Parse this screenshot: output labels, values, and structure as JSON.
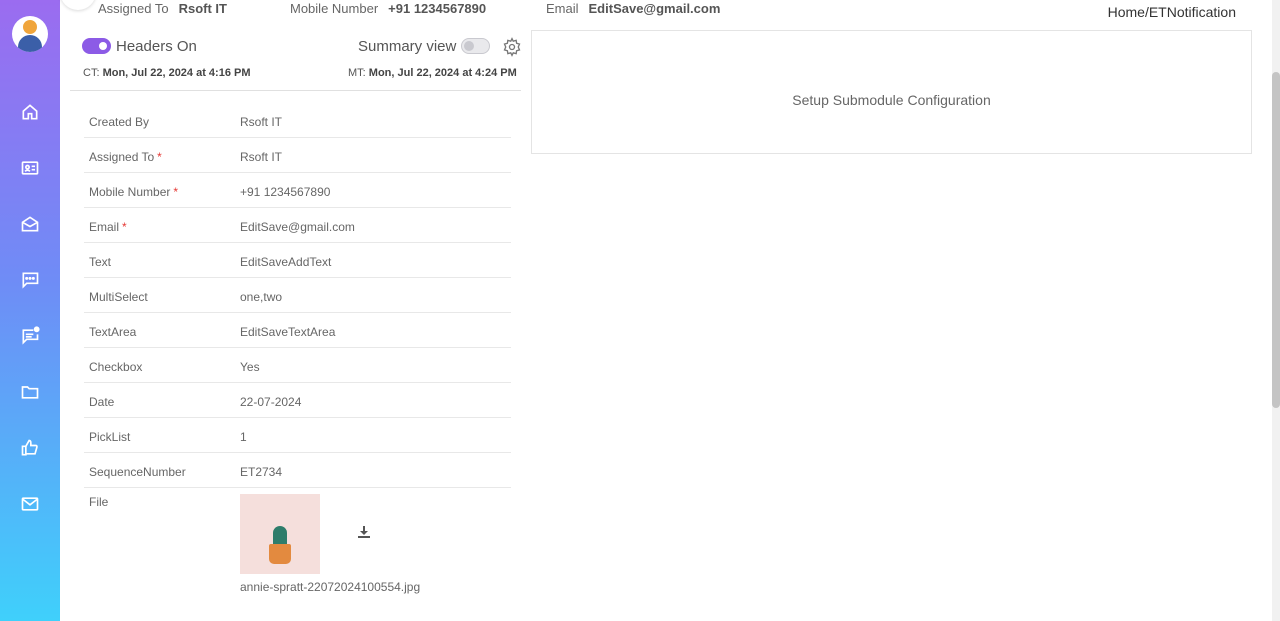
{
  "topbar": {
    "assigned_to_label": "Assigned To",
    "assigned_to_value": "Rsoft  IT",
    "mobile_label": "Mobile Number",
    "mobile_value": "+91 1234567890",
    "email_label": "Email",
    "email_value": "EditSave@gmail.com",
    "breadcrumb": "Home/ETNotification"
  },
  "header_panel": {
    "headers_toggle_label": "Headers On",
    "summary_view_label": "Summary view",
    "ct_label": "CT:",
    "ct_value": "Mon, Jul 22, 2024 at 4:16 PM",
    "mt_label": "MT:",
    "mt_value": "Mon, Jul 22, 2024 at 4:24 PM"
  },
  "fields": [
    {
      "label": "Created By",
      "value": "Rsoft IT",
      "required": ""
    },
    {
      "label": "Assigned To",
      "value": "Rsoft IT",
      "required": "*"
    },
    {
      "label": "Mobile Number",
      "value": "+91   1234567890",
      "required": "*"
    },
    {
      "label": "Email",
      "value": "EditSave@gmail.com",
      "required": "*"
    },
    {
      "label": "Text",
      "value": "EditSaveAddText",
      "required": ""
    },
    {
      "label": "MultiSelect",
      "value": "one,two",
      "required": ""
    },
    {
      "label": "TextArea",
      "value": "EditSaveTextArea",
      "required": ""
    },
    {
      "label": "Checkbox",
      "value": "Yes",
      "required": ""
    },
    {
      "label": "Date",
      "value": "22-07-2024",
      "required": ""
    },
    {
      "label": "PickList",
      "value": "1",
      "required": ""
    },
    {
      "label": "SequenceNumber",
      "value": "ET2734",
      "required": ""
    }
  ],
  "file_field": {
    "label": "File",
    "filename": "annie-spratt-22072024100554.jpg"
  },
  "right_panel": {
    "submodule_text": "Setup Submodule Configuration"
  },
  "sidebar_icons": [
    "home-icon",
    "contact-card-icon",
    "mail-open-icon",
    "chat-icon",
    "notification-chat-icon",
    "folder-icon",
    "thumbs-up-icon",
    "mail-icon"
  ],
  "colors": {
    "sidebar_top": "#9b6cf0",
    "sidebar_bottom": "#3fd0fb",
    "toggle_on": "#8c5be6",
    "required": "#e53935"
  }
}
